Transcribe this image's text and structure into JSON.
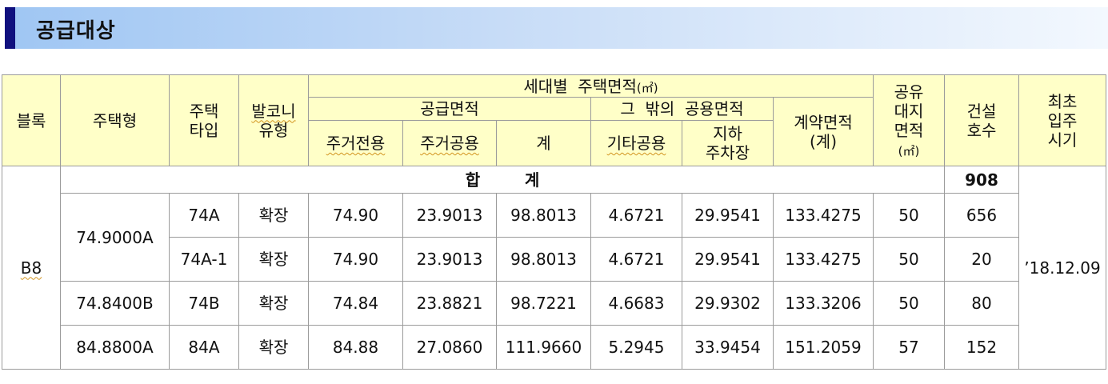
{
  "title": "공급대상",
  "header": {
    "block": "블록",
    "housing_model": "주택형",
    "housing_type": [
      "주택",
      "타입"
    ],
    "balcony": [
      "발코니",
      "유형"
    ],
    "area_group": "세대별  주택면적",
    "area_unit": "(㎡)",
    "supply_area": "공급면적",
    "residential_private": "주거전용",
    "residential_common": "주거공용",
    "subtotal": "계",
    "other_common": "그  밖의  공용면적",
    "etc_common": "기타공용",
    "underground_parking": [
      "지하",
      "주차장"
    ],
    "contract_area": [
      "계약면적",
      "(계)"
    ],
    "shared_land": [
      "공유",
      "대지",
      "면적"
    ],
    "shared_land_unit": "(㎡)",
    "units_built": [
      "건설",
      "호수"
    ],
    "first_move_in": [
      "최초",
      "입주",
      "시기"
    ]
  },
  "block": "B8",
  "total_label": "합        계",
  "total_units": "908",
  "move_in_date": "’18.12.09",
  "rows": [
    {
      "model": "74.9000A",
      "type": "74A",
      "balcony": "확장",
      "private": "74.90",
      "common": "23.9013",
      "subtotal": "98.8013",
      "etc": "4.6721",
      "parking": "29.9541",
      "contract": "133.4275",
      "land": "50",
      "units": "656"
    },
    {
      "model": "",
      "type": "74A-1",
      "balcony": "확장",
      "private": "74.90",
      "common": "23.9013",
      "subtotal": "98.8013",
      "etc": "4.6721",
      "parking": "29.9541",
      "contract": "133.4275",
      "land": "50",
      "units": "20"
    },
    {
      "model": "74.8400B",
      "type": "74B",
      "balcony": "확장",
      "private": "74.84",
      "common": "23.8821",
      "subtotal": "98.7221",
      "etc": "4.6683",
      "parking": "29.9302",
      "contract": "133.3206",
      "land": "50",
      "units": "80"
    },
    {
      "model": "84.8800A",
      "type": "84A",
      "balcony": "확장",
      "private": "84.88",
      "common": "27.0860",
      "subtotal": "111.9660",
      "etc": "5.2945",
      "parking": "33.9454",
      "contract": "151.2059",
      "land": "57",
      "units": "152"
    }
  ]
}
